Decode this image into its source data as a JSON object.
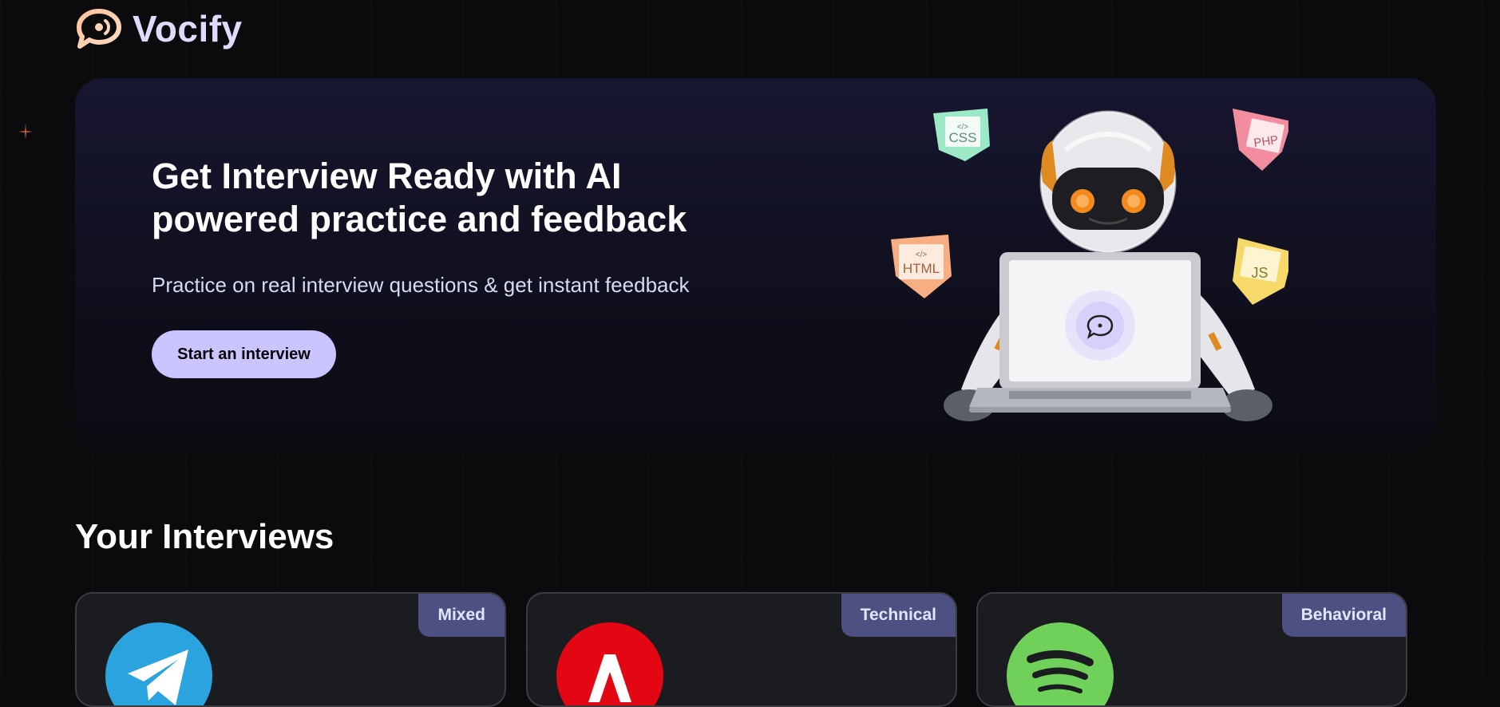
{
  "app": {
    "name": "Vocify"
  },
  "hero": {
    "title_line1": "Get Interview Ready with AI",
    "title_line2": "powered practice and feedback",
    "subtitle": "Practice on real interview questions & get instant feedback",
    "cta_label": "Start an interview",
    "tags": [
      "CSS",
      "PHP",
      "HTML",
      "JS"
    ]
  },
  "interviews": {
    "title": "Your Interviews",
    "cards": [
      {
        "type": "Mixed",
        "logo": "telegram-logo",
        "color": "#2aa3df"
      },
      {
        "type": "Technical",
        "logo": "adobe-logo",
        "color": "#e30613"
      },
      {
        "type": "Behavioral",
        "logo": "spotify-logo",
        "color": "#6fd15a"
      }
    ]
  },
  "colors": {
    "background": "#0b0b0d",
    "accent": "#cac5fe",
    "badge": "#4d5080",
    "brand_text": "#dddcff"
  }
}
